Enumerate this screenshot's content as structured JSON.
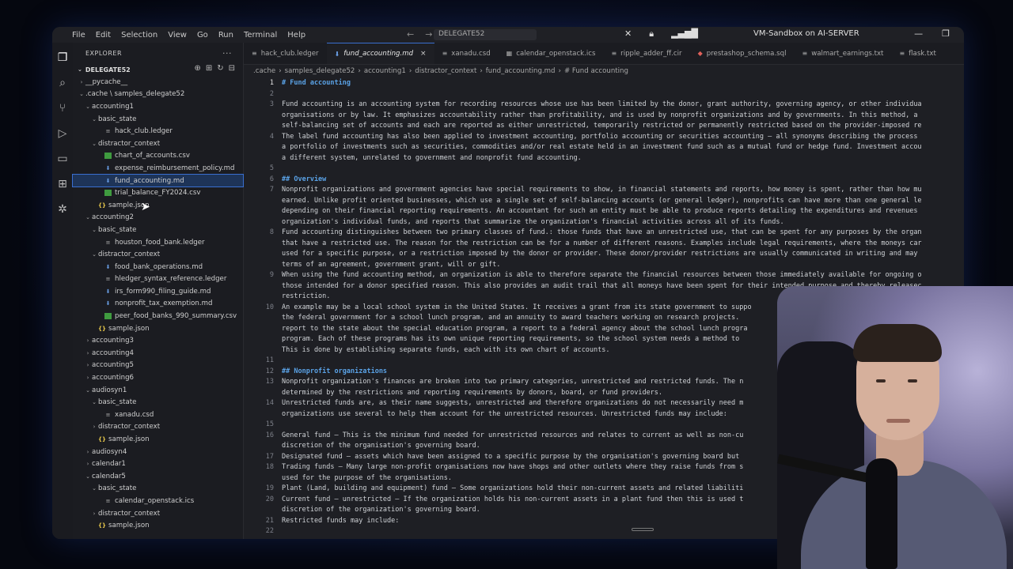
{
  "titlebar": {
    "menus": [
      "File",
      "Edit",
      "Selection",
      "View",
      "Go",
      "Run",
      "Terminal",
      "Help"
    ],
    "command_center": "DELEGATE52",
    "vm_title": "VM-Sandbox on AI-SERVER"
  },
  "sidebar": {
    "title": "EXPLORER",
    "workspace": "DELEGATE52",
    "items": [
      {
        "label": "__pycache__",
        "depth": 1,
        "kind": "folder",
        "open": false
      },
      {
        "label": ".cache \\ samples_delegate52",
        "depth": 1,
        "kind": "folder",
        "open": true
      },
      {
        "label": "accounting1",
        "depth": 2,
        "kind": "folder",
        "open": true
      },
      {
        "label": "basic_state",
        "depth": 3,
        "kind": "folder",
        "open": true
      },
      {
        "label": "hack_club.ledger",
        "depth": 4,
        "kind": "ledger"
      },
      {
        "label": "distractor_context",
        "depth": 3,
        "kind": "folder",
        "open": true
      },
      {
        "label": "chart_of_accounts.csv",
        "depth": 4,
        "kind": "csv"
      },
      {
        "label": "expense_reimbursement_policy.md",
        "depth": 4,
        "kind": "md"
      },
      {
        "label": "fund_accounting.md",
        "depth": 4,
        "kind": "md",
        "selected": true
      },
      {
        "label": "trial_balance_FY2024.csv",
        "depth": 4,
        "kind": "csv"
      },
      {
        "label": "sample.json",
        "depth": 3,
        "kind": "json"
      },
      {
        "label": "accounting2",
        "depth": 2,
        "kind": "folder",
        "open": true
      },
      {
        "label": "basic_state",
        "depth": 3,
        "kind": "folder",
        "open": true
      },
      {
        "label": "houston_food_bank.ledger",
        "depth": 4,
        "kind": "ledger"
      },
      {
        "label": "distractor_context",
        "depth": 3,
        "kind": "folder",
        "open": true
      },
      {
        "label": "food_bank_operations.md",
        "depth": 4,
        "kind": "md"
      },
      {
        "label": "hledger_syntax_reference.ledger",
        "depth": 4,
        "kind": "ledger"
      },
      {
        "label": "irs_form990_filing_guide.md",
        "depth": 4,
        "kind": "md"
      },
      {
        "label": "nonprofit_tax_exemption.md",
        "depth": 4,
        "kind": "md"
      },
      {
        "label": "peer_food_banks_990_summary.csv",
        "depth": 4,
        "kind": "csv"
      },
      {
        "label": "sample.json",
        "depth": 3,
        "kind": "json"
      },
      {
        "label": "accounting3",
        "depth": 2,
        "kind": "folder",
        "open": false
      },
      {
        "label": "accounting4",
        "depth": 2,
        "kind": "folder",
        "open": false
      },
      {
        "label": "accounting5",
        "depth": 2,
        "kind": "folder",
        "open": false
      },
      {
        "label": "accounting6",
        "depth": 2,
        "kind": "folder",
        "open": false
      },
      {
        "label": "audiosyn1",
        "depth": 2,
        "kind": "folder",
        "open": true
      },
      {
        "label": "basic_state",
        "depth": 3,
        "kind": "folder",
        "open": true
      },
      {
        "label": "xanadu.csd",
        "depth": 4,
        "kind": "ledger"
      },
      {
        "label": "distractor_context",
        "depth": 3,
        "kind": "folder",
        "open": false
      },
      {
        "label": "sample.json",
        "depth": 3,
        "kind": "json"
      },
      {
        "label": "audiosyn4",
        "depth": 2,
        "kind": "folder",
        "open": false
      },
      {
        "label": "calendar1",
        "depth": 2,
        "kind": "folder",
        "open": false
      },
      {
        "label": "calendar5",
        "depth": 2,
        "kind": "folder",
        "open": true
      },
      {
        "label": "basic_state",
        "depth": 3,
        "kind": "folder",
        "open": true
      },
      {
        "label": "calendar_openstack.ics",
        "depth": 4,
        "kind": "ledger"
      },
      {
        "label": "distractor_context",
        "depth": 3,
        "kind": "folder",
        "open": false
      },
      {
        "label": "sample.json",
        "depth": 3,
        "kind": "json"
      }
    ]
  },
  "tabs": [
    {
      "label": "hack_club.ledger",
      "icon": "≡",
      "active": false
    },
    {
      "label": "fund_accounting.md",
      "icon": "⬇",
      "active": true
    },
    {
      "label": "xanadu.csd",
      "icon": "≡",
      "active": false
    },
    {
      "label": "calendar_openstack.ics",
      "icon": "▦",
      "active": false
    },
    {
      "label": "ripple_adder_ff.cir",
      "icon": "≡",
      "active": false
    },
    {
      "label": "prestashop_schema.sql",
      "icon": "◆",
      "active": false
    },
    {
      "label": "walmart_earnings.txt",
      "icon": "≡",
      "active": false
    },
    {
      "label": "flask.txt",
      "icon": "≡",
      "active": false
    }
  ],
  "breadcrumb": [
    ".cache",
    "samples_delegate52",
    "accounting1",
    "distractor_context",
    "fund_accounting.md",
    "# Fund accounting"
  ],
  "editor": {
    "lines": [
      {
        "n": "1",
        "t": "# Fund accounting",
        "h": true
      },
      {
        "n": "2",
        "t": ""
      },
      {
        "n": "3",
        "t": "Fund accounting is an accounting system for recording resources whose use has been limited by the donor, grant authority, governing agency, or other individua"
      },
      {
        "n": "",
        "t": "organisations or by law. It emphasizes accountability rather than profitability, and is used by nonprofit organizations and by governments. In this method, a"
      },
      {
        "n": "",
        "t": "self-balancing set of accounts and each are reported as either unrestricted, temporarily restricted or permanently restricted based on the provider-imposed re"
      },
      {
        "n": "4",
        "t": "The label fund accounting has also been applied to investment accounting, portfolio accounting or securities accounting – all synonyms describing the process"
      },
      {
        "n": "",
        "t": "a portfolio of investments such as securities, commodities and/or real estate held in an investment fund such as a mutual fund or hedge fund. Investment accou"
      },
      {
        "n": "",
        "t": "a different system, unrelated to government and nonprofit fund accounting."
      },
      {
        "n": "5",
        "t": ""
      },
      {
        "n": "6",
        "t": "## Overview",
        "h": true
      },
      {
        "n": "7",
        "t": "Nonprofit organizations and government agencies have special requirements to show, in financial statements and reports, how money is spent, rather than how mu"
      },
      {
        "n": "",
        "t": "earned. Unlike profit oriented businesses, which use a single set of self-balancing accounts (or general ledger), nonprofits can have more than one general le"
      },
      {
        "n": "",
        "t": "depending on their financial reporting requirements. An accountant for such an entity must be able to produce reports detailing the expenditures and revenues"
      },
      {
        "n": "",
        "t": "organization's individual funds, and reports that summarize the organization's financial activities across all of its funds."
      },
      {
        "n": "8",
        "t": "Fund accounting distinguishes between two primary classes of fund.: those funds that have an unrestricted use, that can be spent for any purposes by the organ"
      },
      {
        "n": "",
        "t": "that have a restricted use. The reason for the restriction can be for a number of different reasons. Examples include legal requirements, where the moneys car"
      },
      {
        "n": "",
        "t": "used for a specific purpose, or a restriction imposed by the donor or provider. These donor/provider restrictions are usually communicated in writing and may"
      },
      {
        "n": "",
        "t": "terms of an agreement, government grant, will or gift."
      },
      {
        "n": "9",
        "t": "When using the fund accounting method, an organization is able to therefore separate the financial resources between those immediately available for ongoing o"
      },
      {
        "n": "",
        "t": "those intended for a donor specified reason. This also provides an audit trail that all moneys have been spent for their intended purpose and thereby releasec"
      },
      {
        "n": "",
        "t": "restriction."
      },
      {
        "n": "10",
        "t": "An example may be a local school system in the United States. It receives a grant from its state government to suppo"
      },
      {
        "n": "",
        "t": "the federal government for a school lunch program, and an annuity to award teachers working on research projects."
      },
      {
        "n": "",
        "t": "report to the state about the special education program, a report to a federal agency about the school lunch progra"
      },
      {
        "n": "",
        "t": "program. Each of these programs has its own unique reporting requirements, so the school system needs a method to"
      },
      {
        "n": "",
        "t": "This is done by establishing separate funds, each with its own chart of accounts."
      },
      {
        "n": "11",
        "t": ""
      },
      {
        "n": "12",
        "t": "## Nonprofit organizations",
        "h": true
      },
      {
        "n": "13",
        "t": "Nonprofit organization's finances are broken into two primary categories, unrestricted and restricted funds. The n"
      },
      {
        "n": "",
        "t": "determined by the restrictions and reporting requirements by donors, board, or fund providers."
      },
      {
        "n": "14",
        "t": "Unrestricted funds are, as their name suggests, unrestricted and therefore organizations do not necessarily need m"
      },
      {
        "n": "",
        "t": "organizations use several to help them account for the unrestricted resources. Unrestricted funds may include:"
      },
      {
        "n": "15",
        "t": ""
      },
      {
        "n": "16",
        "t": "General fund – This is the minimum fund needed for unrestricted resources and relates to current as well as non-cu"
      },
      {
        "n": "",
        "t": "discretion of the organisation's governing board."
      },
      {
        "n": "17",
        "t": "Designated fund – assets which have been assigned to a specific purpose by the organisation's governing board but"
      },
      {
        "n": "18",
        "t": "Trading funds – Many large non-profit organisations now have shops and other outlets where they raise funds from s"
      },
      {
        "n": "",
        "t": "used for the purpose of the organisations."
      },
      {
        "n": "19",
        "t": "Plant (Land, building and equipment) fund – Some organizations hold their non-current assets and related liabiliti"
      },
      {
        "n": "20",
        "t": "Current fund – unrestricted – If the organization holds his non-current assets in a plant fund then this is used t"
      },
      {
        "n": "",
        "t": "discretion of the organization's governing board."
      },
      {
        "n": "21",
        "t": "Restricted funds may include:"
      },
      {
        "n": "22",
        "t": ""
      }
    ]
  }
}
